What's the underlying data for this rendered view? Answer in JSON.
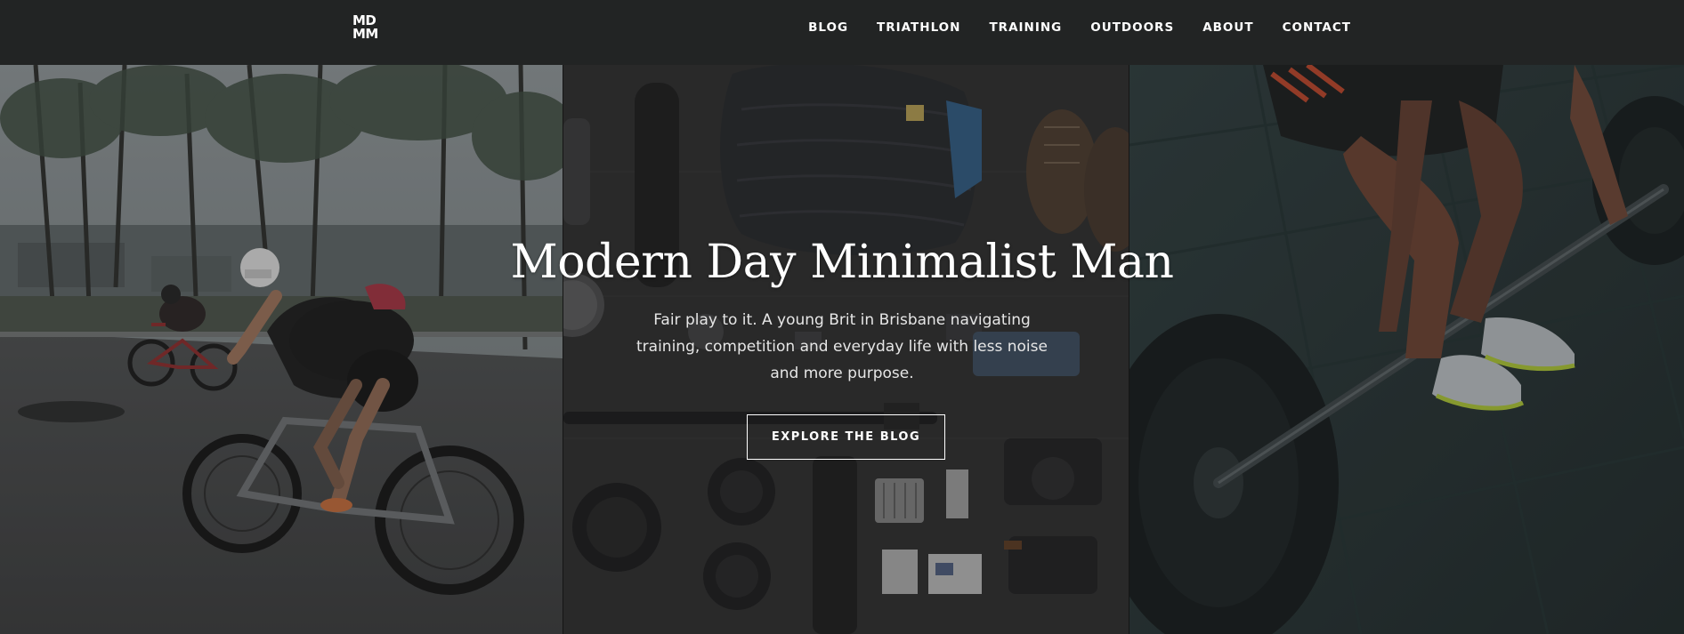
{
  "header": {
    "logo": {
      "line1": "MD",
      "line2": "MM"
    },
    "nav": [
      {
        "label": "BLOG"
      },
      {
        "label": "TRIATHLON"
      },
      {
        "label": "TRAINING"
      },
      {
        "label": "OUTDOORS"
      },
      {
        "label": "ABOUT"
      },
      {
        "label": "CONTACT"
      }
    ]
  },
  "hero": {
    "title": "Modern Day Minimalist Man",
    "subtitle": "Fair play to it. A young Brit in Brisbane navigating training, competition and everyday life with less noise and more purpose.",
    "cta_label": "EXPLORE THE BLOG"
  },
  "colors": {
    "header_bg": "#222424",
    "text": "#ffffff",
    "overlay": "#1f2020"
  },
  "icons": {
    "panel_1": "cyclists-photo",
    "panel_2": "gear-flatlay-photo",
    "panel_3": "barbell-lift-photo"
  }
}
